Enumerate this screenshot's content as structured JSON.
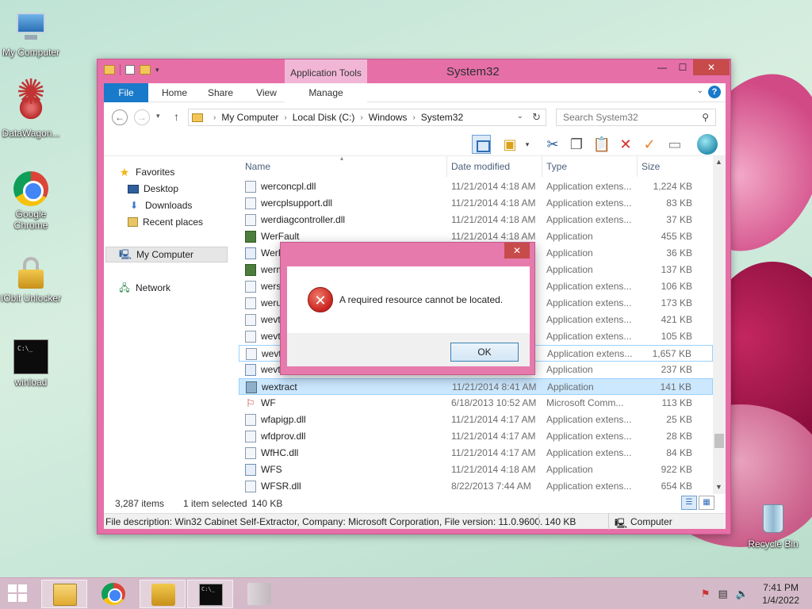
{
  "desktop": {
    "icons": [
      {
        "label": "My Computer"
      },
      {
        "label": "DataWagon..."
      },
      {
        "label": "Google Chrome"
      },
      {
        "label": "IObit Unlocker"
      },
      {
        "label": "winload"
      },
      {
        "label": "Recycle Bin"
      }
    ]
  },
  "window": {
    "title": "System32",
    "contextual_tab": "Application Tools",
    "tabs": {
      "file": "File",
      "home": "Home",
      "share": "Share",
      "view": "View",
      "manage": "Manage"
    },
    "help": "?",
    "controls": {
      "minimize": "—",
      "maximize": "☐",
      "close": "✕"
    }
  },
  "address": {
    "crumbs": [
      "My Computer",
      "Local Disk (C:)",
      "Windows",
      "System32"
    ],
    "search_placeholder": "Search System32"
  },
  "navpane": {
    "favorites": "Favorites",
    "desktop": "Desktop",
    "downloads": "Downloads",
    "recent": "Recent places",
    "computer": "My Computer",
    "network": "Network"
  },
  "columns": {
    "name": "Name",
    "date": "Date modified",
    "type": "Type",
    "size": "Size"
  },
  "files": [
    {
      "name": "werconcpl.dll",
      "date": "11/21/2014 4:18 AM",
      "type": "Application extens...",
      "size": "1,224 KB"
    },
    {
      "name": "wercplsupport.dll",
      "date": "11/21/2014 4:18 AM",
      "type": "Application extens...",
      "size": "83 KB"
    },
    {
      "name": "werdiagcontroller.dll",
      "date": "11/21/2014 4:18 AM",
      "type": "Application extens...",
      "size": "37 KB"
    },
    {
      "name": "WerFault",
      "date": "11/21/2014 4:18 AM",
      "type": "Application",
      "size": "455 KB"
    },
    {
      "name": "WerF",
      "date": "",
      "type": "Application",
      "size": "36 KB"
    },
    {
      "name": "werm",
      "date": "",
      "type": "Application",
      "size": "137 KB"
    },
    {
      "name": "wers",
      "date": "",
      "type": "Application extens...",
      "size": "106 KB"
    },
    {
      "name": "weru",
      "date": "",
      "type": "Application extens...",
      "size": "173 KB"
    },
    {
      "name": "wevt",
      "date": "",
      "type": "Application extens...",
      "size": "421 KB"
    },
    {
      "name": "wevt",
      "date": "",
      "type": "Application extens...",
      "size": "105 KB"
    },
    {
      "name": "wevt",
      "date": "",
      "type": "Application extens...",
      "size": "1,657 KB"
    },
    {
      "name": "wevt",
      "date": "",
      "type": "Application",
      "size": "237 KB"
    },
    {
      "name": "wextract",
      "date": "11/21/2014 8:41 AM",
      "type": "Application",
      "size": "141 KB"
    },
    {
      "name": "WF",
      "date": "6/18/2013 10:52 AM",
      "type": "Microsoft Comm...",
      "size": "113 KB"
    },
    {
      "name": "wfapigp.dll",
      "date": "11/21/2014 4:17 AM",
      "type": "Application extens...",
      "size": "25 KB"
    },
    {
      "name": "wfdprov.dll",
      "date": "11/21/2014 4:17 AM",
      "type": "Application extens...",
      "size": "28 KB"
    },
    {
      "name": "WfHC.dll",
      "date": "11/21/2014 4:17 AM",
      "type": "Application extens...",
      "size": "84 KB"
    },
    {
      "name": "WFS",
      "date": "11/21/2014 4:18 AM",
      "type": "Application",
      "size": "922 KB"
    },
    {
      "name": "WFSR.dll",
      "date": "8/22/2013 7:44 AM",
      "type": "Application extens...",
      "size": "654 KB"
    }
  ],
  "status": {
    "items": "3,287 items",
    "selected": "1 item selected",
    "selected_size": "140 KB"
  },
  "details": {
    "description": "File description: Win32 Cabinet Self-Extractor, Company: Microsoft Corporation, File version: 11.0.9600.",
    "size": "140 KB",
    "location": "Computer"
  },
  "dialog": {
    "close": "✕",
    "message": "A required resource cannot be located.",
    "ok": "OK",
    "error_glyph": "✕"
  },
  "clock": {
    "time": "7:41 PM",
    "date": "1/4/2022"
  }
}
